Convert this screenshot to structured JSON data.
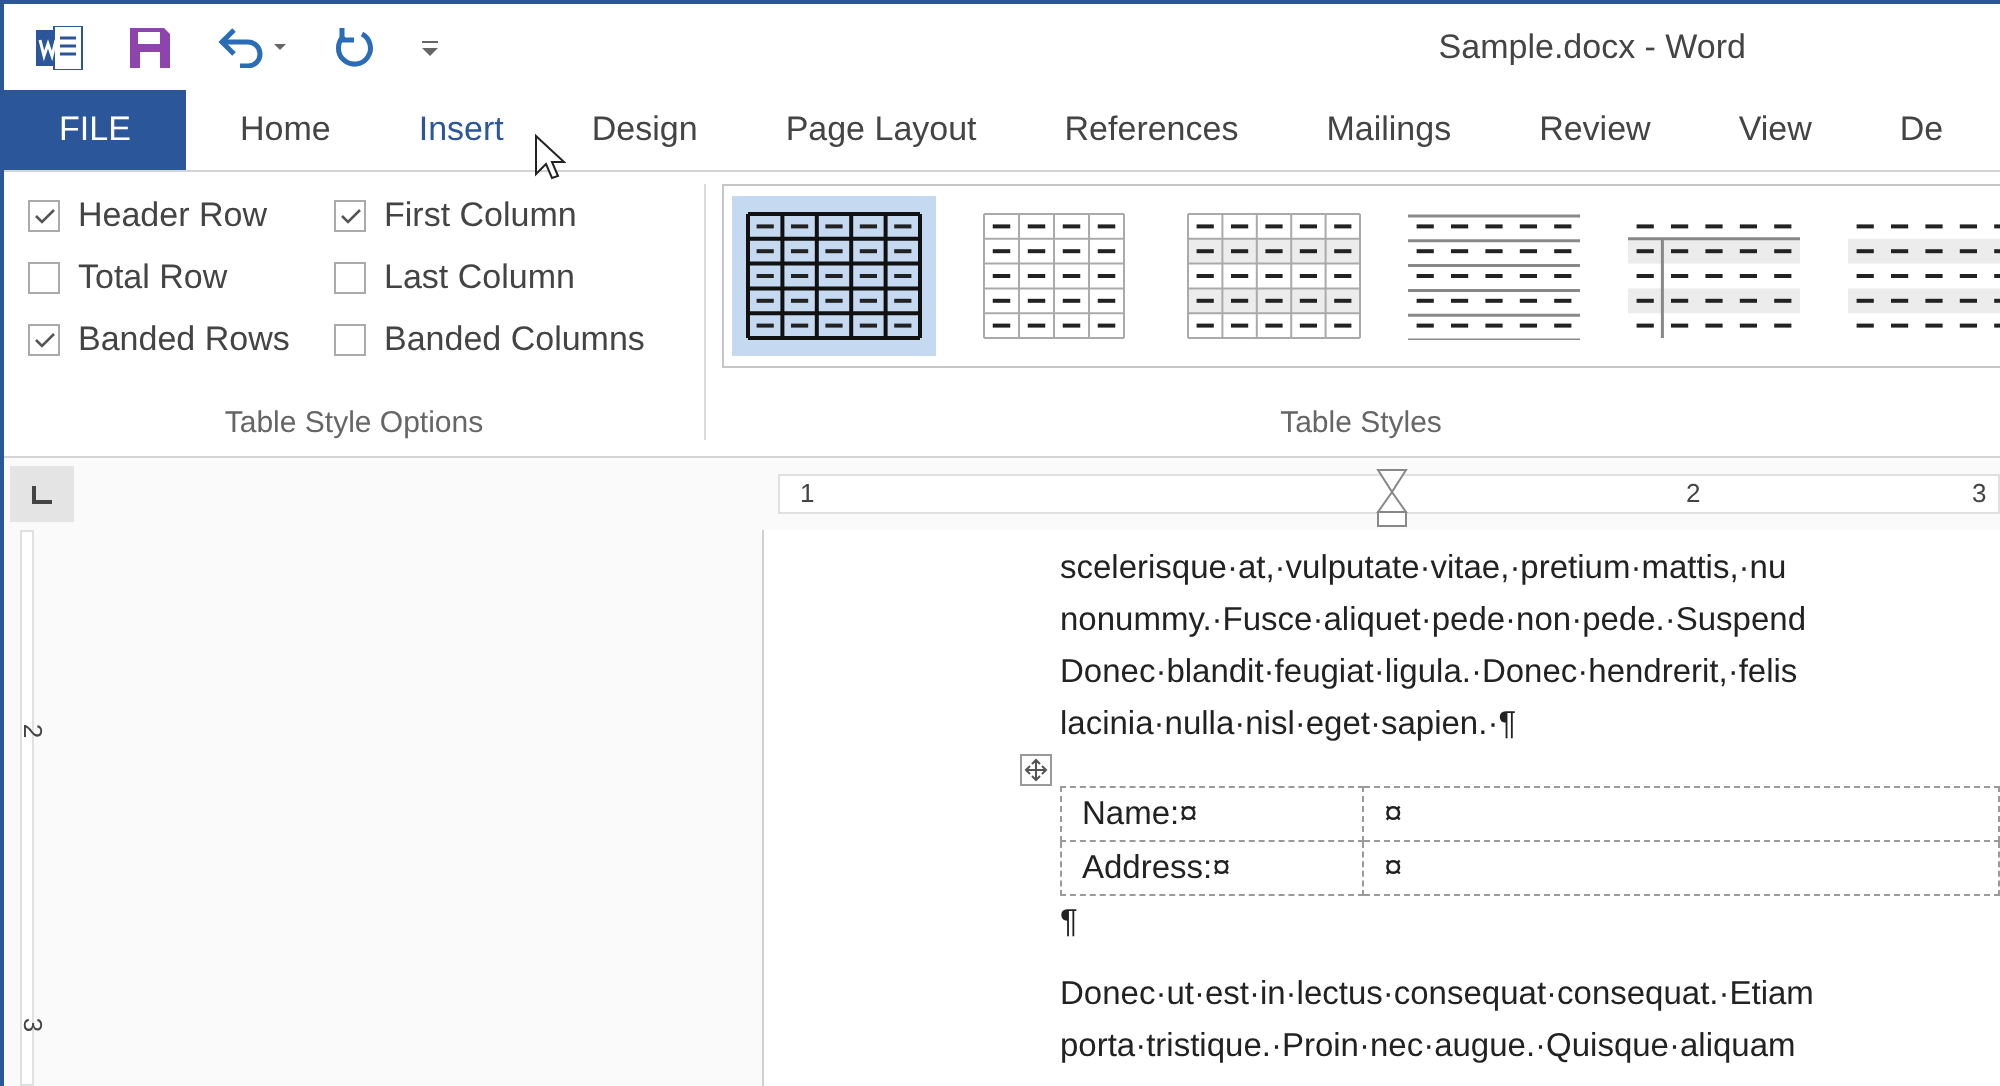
{
  "window": {
    "title": "Sample.docx - Word"
  },
  "tabs": [
    {
      "label": "FILE",
      "kind": "file"
    },
    {
      "label": "Home",
      "kind": "tab",
      "hover": false
    },
    {
      "label": "Insert",
      "kind": "tab",
      "hover": true
    },
    {
      "label": "Design",
      "kind": "tab",
      "hover": false
    },
    {
      "label": "Page Layout",
      "kind": "tab",
      "hover": false
    },
    {
      "label": "References",
      "kind": "tab",
      "hover": false
    },
    {
      "label": "Mailings",
      "kind": "tab",
      "hover": false
    },
    {
      "label": "Review",
      "kind": "tab",
      "hover": false
    },
    {
      "label": "View",
      "kind": "tab",
      "hover": false
    },
    {
      "label": "De",
      "kind": "tab",
      "hover": false
    }
  ],
  "style_options": {
    "label": "Table Style Options",
    "options": [
      {
        "label": "Header Row",
        "checked": true
      },
      {
        "label": "First Column",
        "checked": true
      },
      {
        "label": "Total Row",
        "checked": false
      },
      {
        "label": "Last Column",
        "checked": false
      },
      {
        "label": "Banded Rows",
        "checked": true
      },
      {
        "label": "Banded Columns",
        "checked": false
      }
    ]
  },
  "table_styles": {
    "label": "Table Styles",
    "styles": [
      {
        "kind": "grid-bold",
        "selected": true
      },
      {
        "kind": "grid",
        "selected": false
      },
      {
        "kind": "grid-shaded",
        "selected": false
      },
      {
        "kind": "lines",
        "selected": false
      },
      {
        "kind": "first-column",
        "selected": false
      },
      {
        "kind": "banded",
        "selected": false
      }
    ]
  },
  "ruler": {
    "horizontal": [
      "1",
      "2",
      "3"
    ],
    "vertical": [
      "2",
      "3"
    ]
  },
  "document": {
    "paragraph_1": [
      "scelerisque·at,·vulputate·vitae,·pretium·mattis,·nu",
      "nonummy.·Fusce·aliquet·pede·non·pede.·Suspend",
      "Donec·blandit·feugiat·ligula.·Donec·hendrerit,·felis",
      "lacinia·nulla·nisl·eget·sapien.·¶"
    ],
    "table": [
      [
        "Name:¤",
        "¤"
      ],
      [
        "Address:¤",
        "¤"
      ]
    ],
    "empty_paragraph": "¶",
    "paragraph_2": [
      "Donec·ut·est·in·lectus·consequat·consequat.·Etiam",
      "porta·tristique.·Proin·nec·augue.·Quisque·aliquam"
    ]
  }
}
